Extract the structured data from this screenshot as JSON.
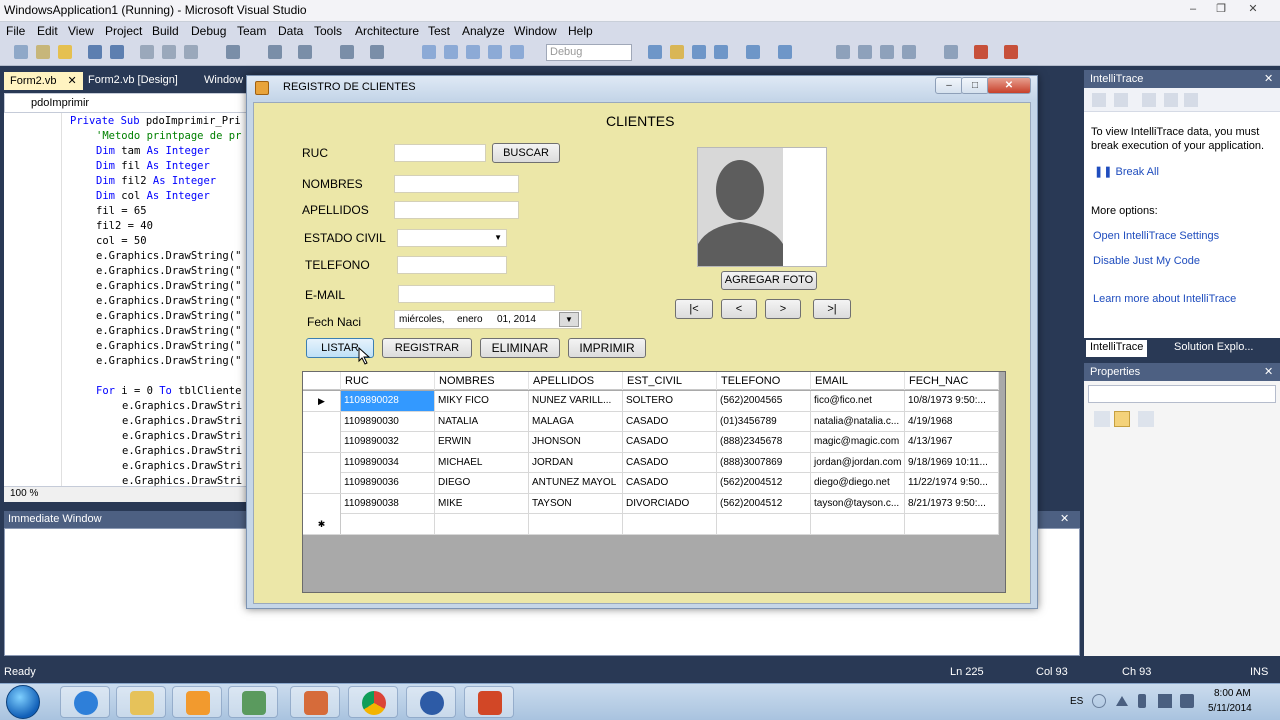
{
  "vs": {
    "window_title": "WindowsApplication1 (Running) - Microsoft Visual Studio",
    "menu": [
      "File",
      "Edit",
      "View",
      "Project",
      "Build",
      "Debug",
      "Team",
      "Data",
      "Tools",
      "Architecture",
      "Test",
      "Analyze",
      "Window",
      "Help"
    ],
    "solution_config": "Debug",
    "doc_tabs": [
      "Form2.vb",
      "Form2.vb [Design]",
      "Window"
    ],
    "editor_nav": "pdoImprimir",
    "zoom": "100 %",
    "code_lines": [
      {
        "indent": 1,
        "parts": [
          {
            "t": "Private Sub ",
            "c": "kw"
          },
          {
            "t": "pdoImprimir_Pri",
            "c": ""
          }
        ]
      },
      {
        "indent": 2,
        "parts": [
          {
            "t": "'Metodo printpage de pr",
            "c": "cm"
          }
        ]
      },
      {
        "indent": 2,
        "parts": [
          {
            "t": "Dim ",
            "c": "kw"
          },
          {
            "t": "tam ",
            "c": ""
          },
          {
            "t": "As Integer",
            "c": "kw"
          }
        ]
      },
      {
        "indent": 2,
        "parts": [
          {
            "t": "Dim ",
            "c": "kw"
          },
          {
            "t": "fil ",
            "c": ""
          },
          {
            "t": "As Integer",
            "c": "kw"
          }
        ]
      },
      {
        "indent": 2,
        "parts": [
          {
            "t": "Dim ",
            "c": "kw"
          },
          {
            "t": "fil2 ",
            "c": ""
          },
          {
            "t": "As Integer",
            "c": "kw"
          }
        ]
      },
      {
        "indent": 2,
        "parts": [
          {
            "t": "Dim ",
            "c": "kw"
          },
          {
            "t": "col ",
            "c": ""
          },
          {
            "t": "As Integer",
            "c": "kw"
          }
        ]
      },
      {
        "indent": 2,
        "parts": [
          {
            "t": "fil = 65",
            "c": ""
          }
        ]
      },
      {
        "indent": 2,
        "parts": [
          {
            "t": "fil2 = 40",
            "c": ""
          }
        ]
      },
      {
        "indent": 2,
        "parts": [
          {
            "t": "col = 50",
            "c": ""
          }
        ]
      },
      {
        "indent": 2,
        "parts": [
          {
            "t": "e.Graphics.DrawString(\"",
            "c": ""
          }
        ]
      },
      {
        "indent": 2,
        "parts": [
          {
            "t": "e.Graphics.DrawString(\"",
            "c": ""
          }
        ]
      },
      {
        "indent": 2,
        "parts": [
          {
            "t": "e.Graphics.DrawString(\"",
            "c": ""
          }
        ]
      },
      {
        "indent": 2,
        "parts": [
          {
            "t": "e.Graphics.DrawString(\"",
            "c": ""
          }
        ]
      },
      {
        "indent": 2,
        "parts": [
          {
            "t": "e.Graphics.DrawString(\"",
            "c": ""
          }
        ]
      },
      {
        "indent": 2,
        "parts": [
          {
            "t": "e.Graphics.DrawString(\"",
            "c": ""
          }
        ]
      },
      {
        "indent": 2,
        "parts": [
          {
            "t": "e.Graphics.DrawString(\"",
            "c": ""
          }
        ]
      },
      {
        "indent": 2,
        "parts": [
          {
            "t": "e.Graphics.DrawString(\"",
            "c": ""
          }
        ]
      },
      {
        "indent": 0,
        "parts": [
          {
            "t": "",
            "c": ""
          }
        ]
      },
      {
        "indent": 2,
        "parts": [
          {
            "t": "For ",
            "c": "kw"
          },
          {
            "t": "i = 0 ",
            "c": ""
          },
          {
            "t": "To ",
            "c": "kw"
          },
          {
            "t": "tblCliente",
            "c": ""
          }
        ]
      },
      {
        "indent": 3,
        "parts": [
          {
            "t": "e.Graphics.DrawStri",
            "c": ""
          }
        ]
      },
      {
        "indent": 3,
        "parts": [
          {
            "t": "e.Graphics.DrawStri",
            "c": ""
          }
        ]
      },
      {
        "indent": 3,
        "parts": [
          {
            "t": "e.Graphics.DrawStri",
            "c": ""
          }
        ]
      },
      {
        "indent": 3,
        "parts": [
          {
            "t": "e.Graphics.DrawStri",
            "c": ""
          }
        ]
      },
      {
        "indent": 3,
        "parts": [
          {
            "t": "e.Graphics.DrawStri",
            "c": ""
          }
        ]
      },
      {
        "indent": 3,
        "parts": [
          {
            "t": "e.Graphics.DrawStri",
            "c": ""
          }
        ]
      }
    ],
    "immediate_title": "Immediate Window",
    "intellitrace": {
      "title": "IntelliTrace",
      "intro": "To view IntelliTrace data, you must break execution of your application.",
      "break_all": "Break All",
      "more_options": "More options:",
      "open_settings": "Open IntelliTrace Settings",
      "disable_jmc": "Disable Just My Code",
      "learn_more": "Learn more about IntelliTrace"
    },
    "panel_tabs": [
      "IntelliTrace",
      "Solution Explo..."
    ],
    "properties_title": "Properties",
    "status": {
      "ready": "Ready",
      "ln": "Ln 225",
      "col": "Col 93",
      "ch": "Ch 93",
      "ins": "INS"
    }
  },
  "form": {
    "title": "REGISTRO DE CLIENTES",
    "heading": "CLIENTES",
    "labels": {
      "ruc": "RUC",
      "nombres": "NOMBRES",
      "apellidos": "APELLIDOS",
      "estado_civil": "ESTADO CIVIL",
      "telefono": "TELEFONO",
      "email": "E-MAIL",
      "fech_naci": "Fech Naci"
    },
    "date_value": {
      "day": "miércoles,",
      "month": "enero",
      "date": "01, 2014"
    },
    "buttons": {
      "buscar": "BUSCAR",
      "agregar_foto": "AGREGAR FOTO",
      "first": "|<",
      "prev": "<",
      "next": ">",
      "last": ">|",
      "listar": "LISTAR",
      "registrar": "REGISTRAR",
      "eliminar": "ELIMINAR",
      "imprimir": "IMPRIMIR"
    },
    "grid": {
      "columns": [
        "RUC",
        "NOMBRES",
        "APELLIDOS",
        "EST_CIVIL",
        "TELEFONO",
        "EMAIL",
        "FECH_NAC"
      ],
      "rows": [
        [
          "1109890028",
          "MIKY FICO",
          "NUNEZ  VARILL...",
          "SOLTERO",
          "(562)2004565",
          "fico@fico.net",
          "10/8/1973 9:50:..."
        ],
        [
          "1109890030",
          "NATALIA",
          "MALAGA",
          "CASADO",
          "(01)3456789",
          "natalia@natalia.c...",
          "4/19/1968"
        ],
        [
          "1109890032",
          "ERWIN",
          "JHONSON",
          "CASADO",
          "(888)2345678",
          "magic@magic.com",
          "4/13/1967"
        ],
        [
          "1109890034",
          "MICHAEL",
          "JORDAN",
          "CASADO",
          "(888)3007869",
          "jordan@jordan.com",
          "9/18/1969 10:11..."
        ],
        [
          "1109890036",
          "DIEGO",
          "ANTUNEZ MAYOL",
          "CASADO",
          "(562)2004512",
          "diego@diego.net",
          "11/22/1974 9:50..."
        ],
        [
          "1109890038",
          "MIKE",
          "TAYSON",
          "DIVORCIADO",
          "(562)2004512",
          "tayson@tayson.c...",
          "8/21/1973 9:50:..."
        ]
      ]
    }
  },
  "taskbar": {
    "lang": "ES",
    "time": "8:00 AM",
    "date": "5/11/2014"
  }
}
